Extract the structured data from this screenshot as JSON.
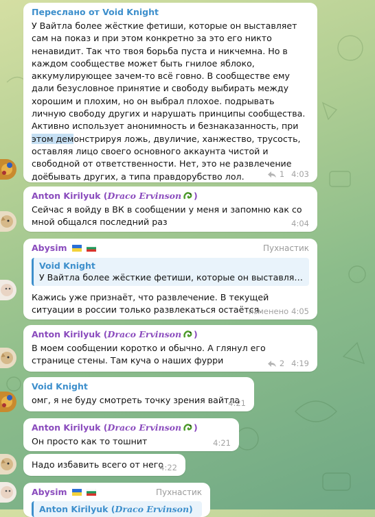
{
  "colors": {
    "accent_blue": "#3d8fcc",
    "name_purple": "#8a4bbd",
    "bubble": "#ffffff",
    "meta": "#a2a2a2",
    "highlight": "#c5dff3"
  },
  "messages": [
    {
      "forwarded_label": "Переслано от Void Knight",
      "text_before": "У Вайтла более жёсткие фетиши, которые он выставляет сам на показ и при этом конкретно за это его никто ненавидит. Так что твоя борьба пуста и никчемна. Но в каждом сообществе может быть гнилое яблоко, аккумулирующее зачем-то всё говно. В сообществе ему дали безусловное принятие и свободу выбирать между хорошим и плохим, но он выбрал плохое. подрывать личную свободу других и нарушать принципы сообщества. Активно использует анонимность и безнаказанность, при ",
      "text_highlight": "этом дем",
      "text_after": "онстрируя ложь, двуличие, ханжество, трусость, оставляя лицо своего основного аккаунта чистой и свободной от ответственности. Нет, это не развлечение доёбывать других, а типа правдорубство лол.",
      "replies": "1",
      "time": "4:03"
    },
    {
      "sender": "Anton Kirilyuk",
      "sender_alt": "Draco Ervinson",
      "text": "Сейчас я войду в ВК в сообщении у меня и запомню как со мной общался последний раз",
      "time": "4:04"
    },
    {
      "sender": "Abysim",
      "role": "Пухнастик",
      "quote_name": "Void Knight",
      "quote_text": "У Вайтла более жёсткие фетиши, которые он выставляет сам ...",
      "text": "Кажись уже признаёт, что развлечение. В текущей ситуации в россии только развлекаться остаётся.",
      "edited": "изменено",
      "time": "4:05"
    },
    {
      "sender": "Anton Kirilyuk",
      "sender_alt": "Draco Ervinson",
      "text": "В моем сообщении коротко и обычно. А глянул его странице стены. Там куча о наших фурри",
      "replies": "2",
      "time": "4:19"
    },
    {
      "sender": "Void Knight",
      "text": "омг, я не буду смотреть точку зрения вайтла",
      "time": "4:21"
    },
    {
      "sender": "Anton Kirilyuk",
      "sender_alt": "Draco Ervinson",
      "text": "Он просто как то тошнит",
      "time": "4:21"
    },
    {
      "text": "Надо избавить всего от него",
      "time": "4:22"
    },
    {
      "sender": "Abysim",
      "role": "Пухнастик",
      "quote_name": "Anton Kirilyuk",
      "quote_alt": "Draco Ervinson"
    }
  ]
}
